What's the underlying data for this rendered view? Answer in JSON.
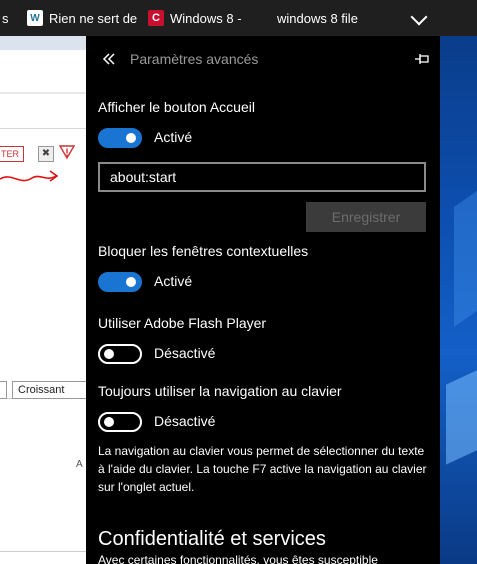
{
  "tabs": [
    {
      "label": "s"
    },
    {
      "label": "Rien ne sert de",
      "icon": "wordpress-icon"
    },
    {
      "label": "Windows 8 -",
      "icon": "c-logo-icon"
    },
    {
      "label": "windows 8 file",
      "icon": "microsoft-logo-icon"
    }
  ],
  "webpage": {
    "ter_button": "TER",
    "close_glyph": "✖",
    "select_value": "Croissant",
    "stray_text": "A"
  },
  "panel": {
    "title": "Paramètres avancés",
    "home_button": {
      "label": "Afficher le bouton Accueil",
      "state": "Activé",
      "on": true
    },
    "home_url": "about:start",
    "save_label": "Enregistrer",
    "popups": {
      "label": "Bloquer les fenêtres contextuelles",
      "state": "Activé",
      "on": true
    },
    "flash": {
      "label": "Utiliser Adobe Flash Player",
      "state": "Désactivé",
      "on": false
    },
    "keyboard_nav": {
      "label": "Toujours utiliser la navigation au clavier",
      "state": "Désactivé",
      "on": false
    },
    "keyboard_help": "La navigation au clavier vous permet de sélectionner du texte à l'aide du clavier. La touche F7 active la navigation au clavier sur l'onglet actuel.",
    "privacy_title": "Confidentialité et services",
    "privacy_sub": "Avec certaines fonctionnalités, vous êtes susceptible"
  },
  "colors": {
    "accent": "#1a75d2",
    "panel_bg": "#000000",
    "title_gray": "#9a9a9a"
  }
}
